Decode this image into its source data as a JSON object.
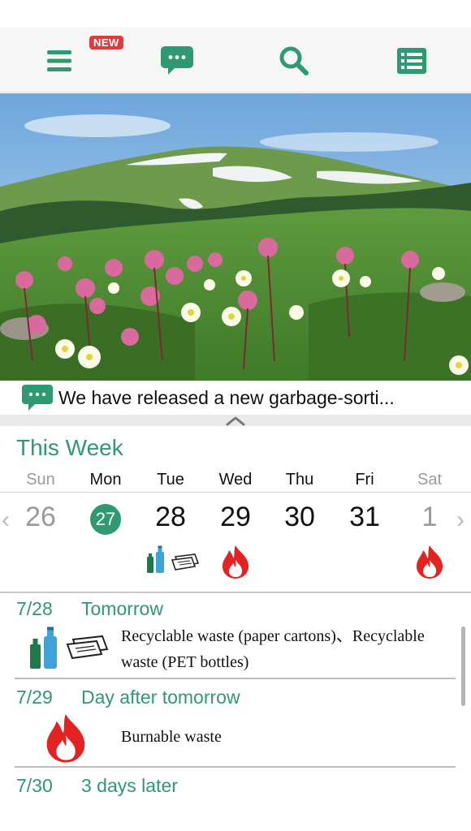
{
  "toolbar": {
    "new_badge": "NEW",
    "icons": [
      "menu-icon",
      "chat-icon",
      "search-icon",
      "list-icon"
    ],
    "accent": "#2f9a72",
    "badge_color": "#e23a3a"
  },
  "news": {
    "text": "We have released a new garbage-sorti..."
  },
  "week": {
    "title": "This Week",
    "day_names": [
      "Sun",
      "Mon",
      "Tue",
      "Wed",
      "Thu",
      "Fri",
      "Sat"
    ],
    "dates": [
      "26",
      "27",
      "28",
      "29",
      "30",
      "31",
      "1"
    ],
    "today_index": 1,
    "prev_arrow": "‹",
    "next_arrow": "›"
  },
  "schedule": [
    {
      "date": "7/28",
      "relative": "Tomorrow",
      "description": "Recyclable waste (paper cartons)、Recyclable waste (PET bottles)",
      "icons": [
        "pet-bottle-icon",
        "paper-carton-icon"
      ]
    },
    {
      "date": "7/29",
      "relative": "Day after tomorrow",
      "description": "Burnable waste",
      "icons": [
        "fire-icon"
      ]
    },
    {
      "date": "7/30",
      "relative": "3 days later",
      "description": "",
      "icons": []
    }
  ]
}
